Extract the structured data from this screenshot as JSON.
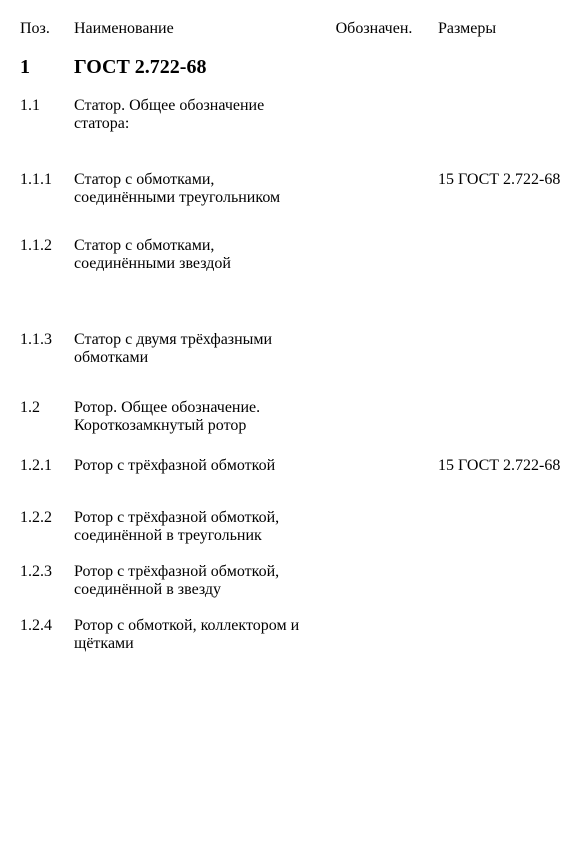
{
  "headers": {
    "num": "Поз.",
    "name": "Наименование",
    "symbol": "Обозначен.",
    "size": "Размеры"
  },
  "section1": {
    "num": "1",
    "title": "ГОСТ 2.722-68"
  },
  "rows": {
    "r11": {
      "num": "1.1",
      "name": "Статор. Общее обозначение статора:"
    },
    "r111": {
      "num": "1.1.1",
      "name": "Статор с обмотками, соединёнными треугольником",
      "size": "15 ГОСТ 2.722-68"
    },
    "r112": {
      "num": "1.1.2",
      "name": "Статор с обмотками, соединёнными звездой"
    },
    "r113": {
      "num": "1.1.3",
      "name": "Статор с двумя трёхфазными обмотками"
    },
    "r12": {
      "num": "1.2",
      "name": "Ротор. Общее обозначение. Короткозамкнутый ротор"
    },
    "r121": {
      "num": "1.2.1",
      "name": "Ротор с трёхфазной обмоткой",
      "size": "15 ГОСТ 2.722-68"
    },
    "r122": {
      "num": "1.2.2",
      "name": "Ротор с трёхфазной обмоткой, соединённой в треугольник"
    },
    "r123": {
      "num": "1.2.3",
      "name": "Ротор с трёхфазной обмоткой, соединённой в звезду"
    },
    "r124": {
      "num": "1.2.4",
      "name": "Ротор с обмоткой, коллектором и щётками"
    }
  }
}
